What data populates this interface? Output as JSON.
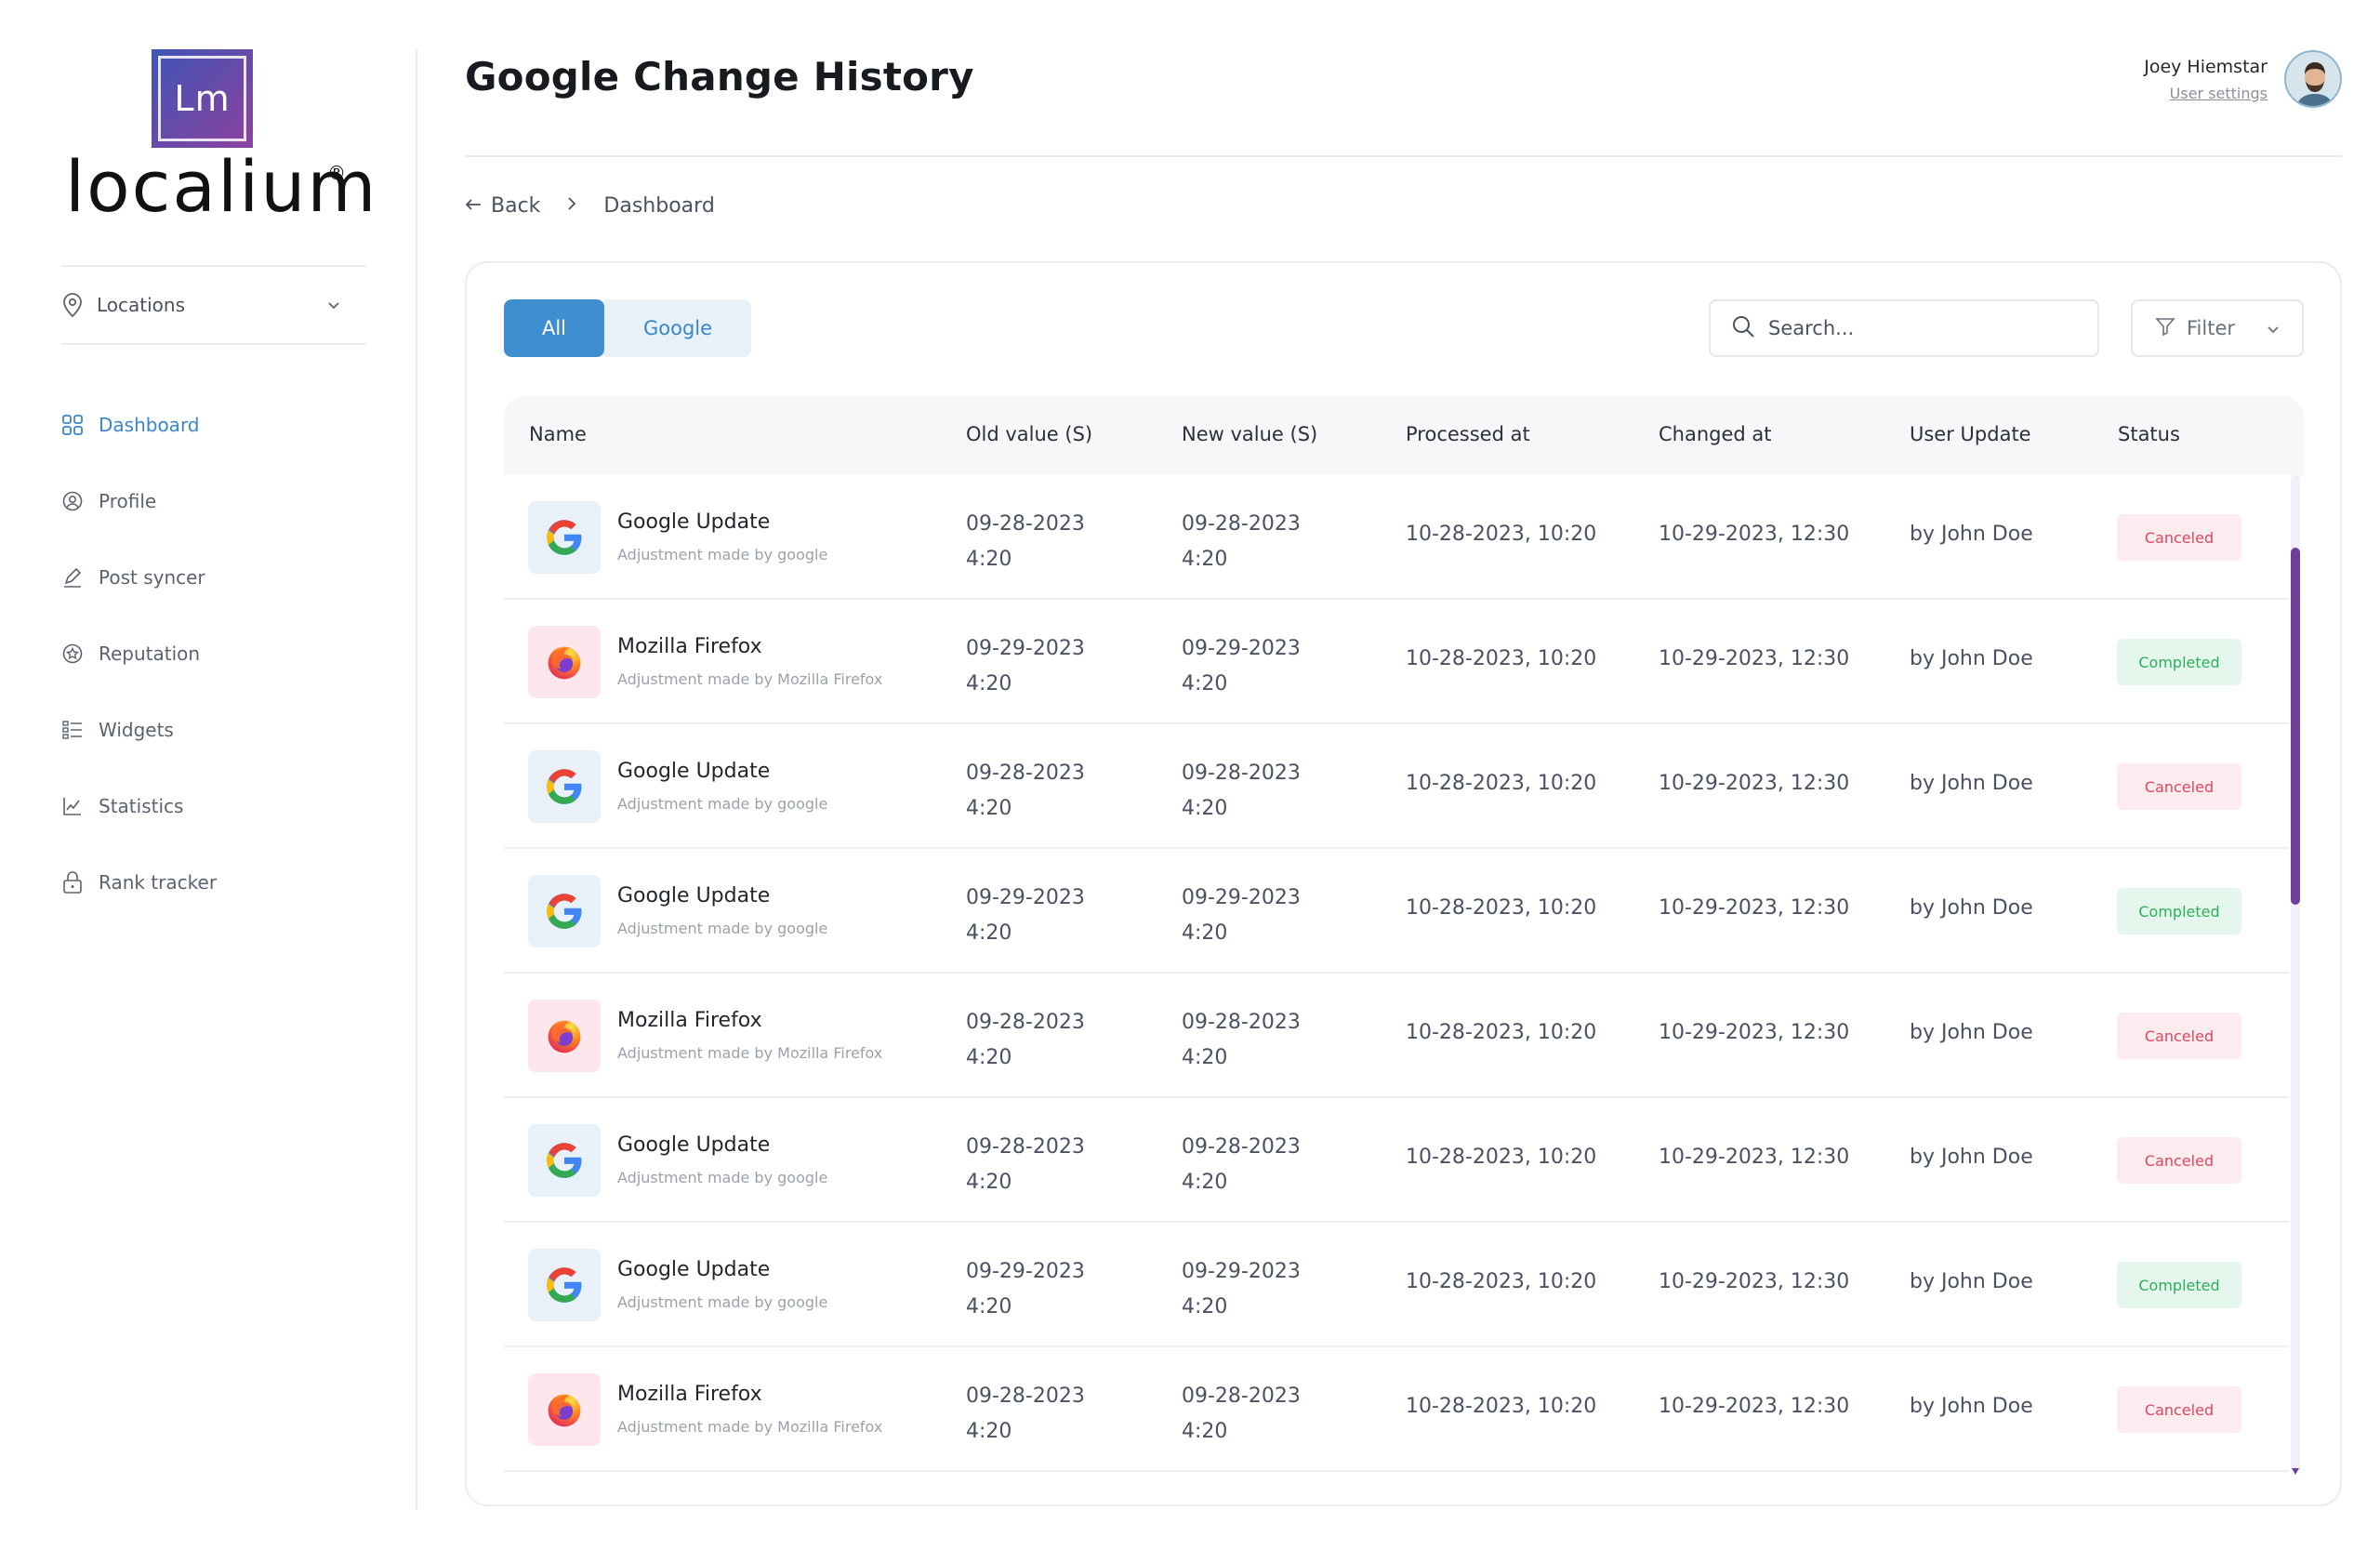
{
  "brand": {
    "logo_mark": "Lm",
    "wordmark": "localium",
    "registered": "®"
  },
  "sidebar": {
    "location_select": "Locations",
    "items": [
      {
        "label": "Dashboard",
        "icon": "grid-icon",
        "active": true
      },
      {
        "label": "Profile",
        "icon": "user-circle-icon",
        "active": false
      },
      {
        "label": "Post syncer",
        "icon": "pen-icon",
        "active": false
      },
      {
        "label": "Reputation",
        "icon": "star-badge-icon",
        "active": false
      },
      {
        "label": "Widgets",
        "icon": "list-icon",
        "active": false
      },
      {
        "label": "Statistics",
        "icon": "chart-icon",
        "active": false
      },
      {
        "label": "Rank tracker",
        "icon": "lock-icon",
        "active": false
      }
    ]
  },
  "header": {
    "title": "Google Change History",
    "user_name": "Joey Hiemstar",
    "user_settings": "User settings"
  },
  "breadcrumb": {
    "back": "Back",
    "current": "Dashboard"
  },
  "toolbar": {
    "tab_all": "All",
    "tab_google": "Google",
    "search_placeholder": "Search...",
    "filter_label": "Filter"
  },
  "table": {
    "columns": {
      "name": "Name",
      "old_value": "Old value (S)",
      "new_value": "New value (S)",
      "processed_at": "Processed at",
      "changed_at": "Changed at",
      "user_update": "User Update",
      "status": "Status"
    },
    "rows": [
      {
        "app": "google",
        "title": "Google Update",
        "subtitle": "Adjustment made by google",
        "old_date": "09-28-2023",
        "old_time": "4:20",
        "new_date": "09-28-2023",
        "new_time": "4:20",
        "processed": "10-28-2023, 10:20",
        "changed": "10-29-2023, 12:30",
        "user": "by John Doe",
        "status": "Canceled"
      },
      {
        "app": "firefox",
        "title": "Mozilla Firefox",
        "subtitle": "Adjustment made by Mozilla Firefox",
        "old_date": "09-29-2023",
        "old_time": "4:20",
        "new_date": "09-29-2023",
        "new_time": "4:20",
        "processed": "10-28-2023, 10:20",
        "changed": "10-29-2023, 12:30",
        "user": "by John Doe",
        "status": "Completed"
      },
      {
        "app": "google",
        "title": "Google Update",
        "subtitle": "Adjustment made by google",
        "old_date": "09-28-2023",
        "old_time": "4:20",
        "new_date": "09-28-2023",
        "new_time": "4:20",
        "processed": "10-28-2023, 10:20",
        "changed": "10-29-2023, 12:30",
        "user": "by John Doe",
        "status": "Canceled"
      },
      {
        "app": "google",
        "title": "Google Update",
        "subtitle": "Adjustment made by google",
        "old_date": "09-29-2023",
        "old_time": "4:20",
        "new_date": "09-29-2023",
        "new_time": "4:20",
        "processed": "10-28-2023, 10:20",
        "changed": "10-29-2023, 12:30",
        "user": "by John Doe",
        "status": "Completed"
      },
      {
        "app": "firefox",
        "title": "Mozilla Firefox",
        "subtitle": "Adjustment made by Mozilla Firefox",
        "old_date": "09-28-2023",
        "old_time": "4:20",
        "new_date": "09-28-2023",
        "new_time": "4:20",
        "processed": "10-28-2023, 10:20",
        "changed": "10-29-2023, 12:30",
        "user": "by John Doe",
        "status": "Canceled"
      },
      {
        "app": "google",
        "title": "Google Update",
        "subtitle": "Adjustment made by google",
        "old_date": "09-28-2023",
        "old_time": "4:20",
        "new_date": "09-28-2023",
        "new_time": "4:20",
        "processed": "10-28-2023, 10:20",
        "changed": "10-29-2023, 12:30",
        "user": "by John Doe",
        "status": "Canceled"
      },
      {
        "app": "google",
        "title": "Google Update",
        "subtitle": "Adjustment made by google",
        "old_date": "09-29-2023",
        "old_time": "4:20",
        "new_date": "09-29-2023",
        "new_time": "4:20",
        "processed": "10-28-2023, 10:20",
        "changed": "10-29-2023, 12:30",
        "user": "by John Doe",
        "status": "Completed"
      },
      {
        "app": "firefox",
        "title": "Mozilla Firefox",
        "subtitle": "Adjustment made by Mozilla Firefox",
        "old_date": "09-28-2023",
        "old_time": "4:20",
        "new_date": "09-28-2023",
        "new_time": "4:20",
        "processed": "10-28-2023, 10:20",
        "changed": "10-29-2023, 12:30",
        "user": "by John Doe",
        "status": "Canceled"
      }
    ]
  },
  "colors": {
    "accent": "#3e8ed0",
    "accent_text": "#3b86c8",
    "canceled_bg": "#fdecef",
    "canceled_text": "#d9485f",
    "completed_bg": "#e5f7ec",
    "completed_text": "#2dae5c",
    "scroll_thumb": "#6d3f9b"
  }
}
